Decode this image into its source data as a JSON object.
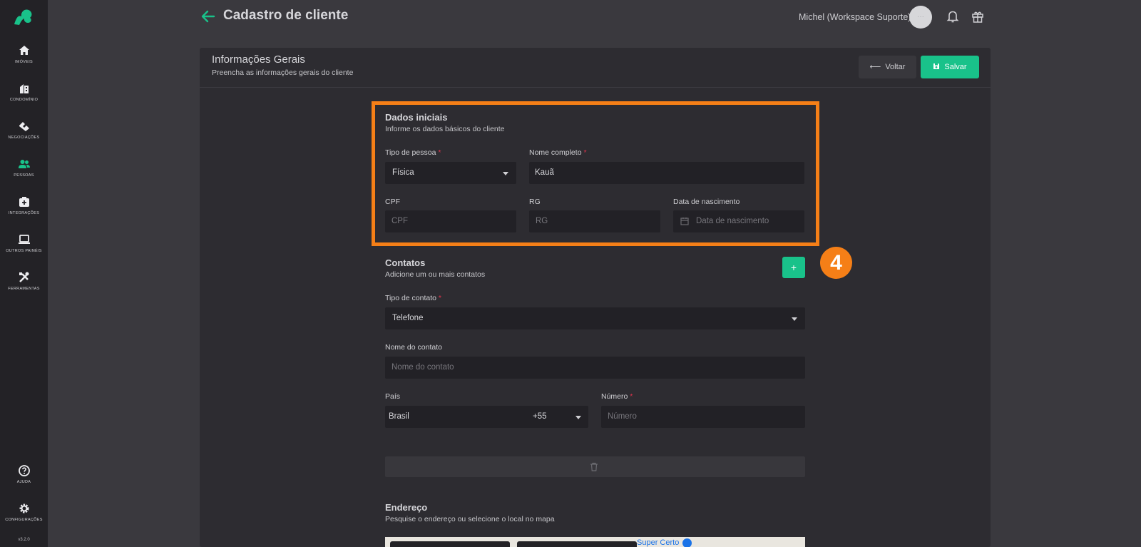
{
  "sidebar": {
    "items": [
      {
        "label": "Imóveis",
        "icon": "home-icon"
      },
      {
        "label": "Condomínio",
        "icon": "building-icon"
      },
      {
        "label": "Negociações",
        "icon": "handshake-icon"
      },
      {
        "label": "Pessoas",
        "icon": "people-icon"
      },
      {
        "label": "Integrações",
        "icon": "plugin-icon"
      },
      {
        "label": "Outros painéis",
        "icon": "laptop-icon"
      },
      {
        "label": "Ferramentas",
        "icon": "tools-icon"
      },
      {
        "label": "Ajuda",
        "icon": "help-icon"
      },
      {
        "label": "Configurações",
        "icon": "gear-icon"
      }
    ],
    "version": "v3.2.0"
  },
  "header": {
    "title": "Cadastro de cliente",
    "user": "Michel (Workspace Suporte)",
    "avatar_text": "···"
  },
  "card": {
    "title": "Informações Gerais",
    "subtitle": "Preencha as informações gerais do cliente",
    "back_label": "Voltar",
    "save_label": "Salvar"
  },
  "dados": {
    "title": "Dados iniciais",
    "subtitle": "Informe os dados básicos do cliente",
    "tipo_label": "Tipo de pessoa",
    "tipo_value": "Física",
    "nome_label": "Nome completo",
    "nome_value": "Kauã",
    "cpf_label": "CPF",
    "cpf_placeholder": "CPF",
    "rg_label": "RG",
    "rg_placeholder": "RG",
    "nasc_label": "Data de nascimento",
    "nasc_placeholder": "Data de nascimento"
  },
  "contatos": {
    "title": "Contatos",
    "subtitle": "Adicione um ou mais contatos",
    "add_label": "+",
    "tipo_label": "Tipo de contato",
    "tipo_value": "Telefone",
    "nome_label": "Nome do contato",
    "nome_placeholder": "Nome do contato",
    "pais_label": "País",
    "pais_value": "Brasil",
    "ddi_value": "+55",
    "numero_label": "Número",
    "numero_placeholder": "Número"
  },
  "endereco": {
    "title": "Endereço",
    "subtitle": "Pesquise o endereço ou selecione o local no mapa",
    "map_poi": "Super Certo"
  },
  "required_mark": "*",
  "step_badge": "4",
  "colors": {
    "accent": "#19c28a",
    "highlight": "#f57f17",
    "required": "#e0344d"
  }
}
